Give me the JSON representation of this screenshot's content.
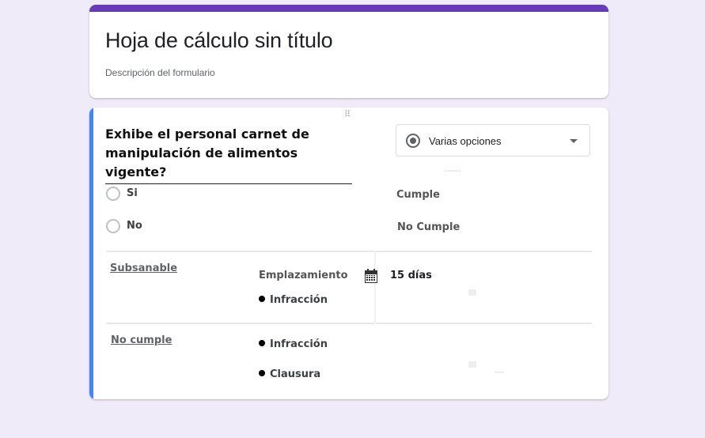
{
  "form": {
    "title": "Hoja de cálculo sin título",
    "description": "Descripción del formulario",
    "accent_color": "#673ab7"
  },
  "question": {
    "text": "Exhibe el personal carnet de manipulación de alimentos vigente?",
    "type_label": "Varias opciones",
    "accent_color": "#4285f4",
    "options": [
      {
        "label": "Si",
        "side_label": "Cumple"
      },
      {
        "label": "No",
        "side_label": "No Cumple"
      }
    ]
  },
  "rows": [
    {
      "label": "Subsanable",
      "detail_label": "Emplazamiento",
      "deadline": "15 días",
      "items": [
        "Infracción"
      ]
    },
    {
      "label": "No cumple",
      "items": [
        "Infracción",
        "Clausura"
      ]
    }
  ],
  "icons": {
    "type_icon": "radio-button-icon",
    "dropdown_icon": "caret-down-icon",
    "drag_icon": "drag-handle-icon",
    "calendar_icon": "calendar-icon"
  }
}
